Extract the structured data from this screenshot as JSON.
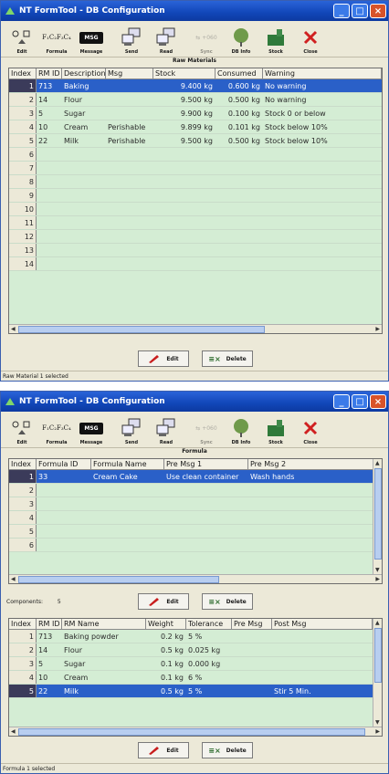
{
  "window1": {
    "title": "NT FormTool - DB Configuration",
    "section_label": "Raw Materials",
    "columns": [
      "Index",
      "RM ID",
      "Description",
      "Msg",
      "Stock",
      "Consumed",
      "Warning"
    ],
    "rows": [
      {
        "index": "1",
        "rm_id": "713",
        "description": "Baking",
        "msg": "",
        "stock": "9.400 kg",
        "consumed": "0.600 kg",
        "warning": "No warning",
        "selected": true
      },
      {
        "index": "2",
        "rm_id": "14",
        "description": "Flour",
        "msg": "",
        "stock": "9.500 kg",
        "consumed": "0.500 kg",
        "warning": "No warning",
        "selected": false
      },
      {
        "index": "3",
        "rm_id": "5",
        "description": "Sugar",
        "msg": "",
        "stock": "9.900 kg",
        "consumed": "0.100 kg",
        "warning": "Stock 0 or below",
        "selected": false
      },
      {
        "index": "4",
        "rm_id": "10",
        "description": "Cream",
        "msg": "Perishable",
        "stock": "9.899 kg",
        "consumed": "0.101 kg",
        "warning": "Stock below 10%",
        "selected": false
      },
      {
        "index": "5",
        "rm_id": "22",
        "description": "Milk",
        "msg": "Perishable",
        "stock": "9.500 kg",
        "consumed": "0.500 kg",
        "warning": "Stock below 10%",
        "selected": false
      },
      {
        "index": "6"
      },
      {
        "index": "7"
      },
      {
        "index": "8"
      },
      {
        "index": "9"
      },
      {
        "index": "10"
      },
      {
        "index": "11"
      },
      {
        "index": "12"
      },
      {
        "index": "13"
      },
      {
        "index": "14"
      }
    ],
    "edit_label": "Edit",
    "delete_label": "Delete",
    "status": "Raw Material 1 selected"
  },
  "window2": {
    "title": "NT FormTool - DB Configuration",
    "section_label": "Formula",
    "formula_columns": [
      "Index",
      "Formula ID",
      "Formula Name",
      "Pre Msg 1",
      "Pre Msg 2"
    ],
    "formula_rows": [
      {
        "index": "1",
        "formula_id": "33",
        "formula_name": "Cream Cake",
        "pre_msg_1": "Use clean container",
        "pre_msg_2": "Wash hands",
        "selected": true
      },
      {
        "index": "2"
      },
      {
        "index": "3"
      },
      {
        "index": "4"
      },
      {
        "index": "5"
      },
      {
        "index": "6"
      }
    ],
    "components_label": "Components:",
    "components_count": "5",
    "component_columns": [
      "Index",
      "RM ID",
      "RM Name",
      "Weight",
      "Tolerance",
      "Pre Msg",
      "Post Msg"
    ],
    "component_rows": [
      {
        "index": "1",
        "rm_id": "713",
        "rm_name": "Baking powder",
        "weight": "0.2 kg",
        "tolerance": "5 %",
        "pre_msg": "",
        "post_msg": "",
        "selected": false
      },
      {
        "index": "2",
        "rm_id": "14",
        "rm_name": "Flour",
        "weight": "0.5 kg",
        "tolerance": "0.025 kg",
        "pre_msg": "",
        "post_msg": "",
        "selected": false
      },
      {
        "index": "3",
        "rm_id": "5",
        "rm_name": "Sugar",
        "weight": "0.1 kg",
        "tolerance": "0.000 kg",
        "pre_msg": "",
        "post_msg": "",
        "selected": false
      },
      {
        "index": "4",
        "rm_id": "10",
        "rm_name": "Cream",
        "weight": "0.1 kg",
        "tolerance": "6 %",
        "pre_msg": "",
        "post_msg": "",
        "selected": false
      },
      {
        "index": "5",
        "rm_id": "22",
        "rm_name": "Milk",
        "weight": "0.5 kg",
        "tolerance": "5 %",
        "pre_msg": "",
        "post_msg": "Stir 5 Min.",
        "selected": true
      }
    ],
    "edit_label": "Edit",
    "delete_label": "Delete",
    "status": "Formula 1 selected"
  },
  "toolbar": [
    {
      "label": "Edit",
      "icon": "radio-checkbox-icon",
      "disabled": false
    },
    {
      "label": "Formula",
      "icon": "formula-icon",
      "disabled": false
    },
    {
      "label": "Message",
      "icon": "message-icon",
      "disabled": false
    },
    {
      "label": "Send",
      "icon": "send-computer-icon",
      "disabled": false
    },
    {
      "label": "Read",
      "icon": "read-computer-icon",
      "disabled": false
    },
    {
      "label": "Sync",
      "icon": "sync-icon",
      "disabled": true
    },
    {
      "label": "DB Info",
      "icon": "globe-icon",
      "disabled": false
    },
    {
      "label": "Stock",
      "icon": "stock-barn-icon",
      "disabled": false
    },
    {
      "label": "Close",
      "icon": "close-x-icon",
      "disabled": false
    }
  ],
  "formula_glyph": "F₁C₂F₃C₄",
  "message_glyph": "MSG",
  "sync_glyph": "⇆ +060",
  "colors": {
    "grid_bg": "#d4edd4",
    "selection": "#2a60c8",
    "titlebar": "#1146b8"
  }
}
